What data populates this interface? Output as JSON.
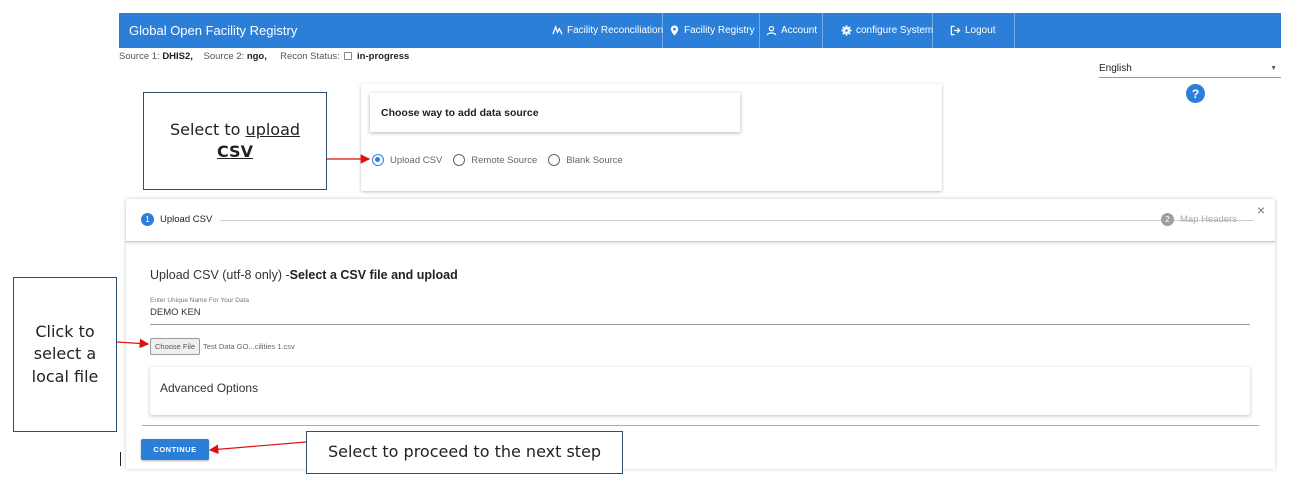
{
  "header": {
    "brand": "Global Open Facility Registry",
    "nav": [
      {
        "label": "Facility Reconciliation",
        "icon": "reconciliation-icon"
      },
      {
        "label": "Facility Registry",
        "icon": "location-pin-icon"
      },
      {
        "label": "Account",
        "icon": "user-icon"
      },
      {
        "label": "configure System",
        "icon": "gear-icon"
      },
      {
        "label": "Logout",
        "icon": "logout-icon"
      }
    ],
    "color": "#2b7fd8"
  },
  "status": {
    "source1_label": "Source 1:",
    "source1_value": "DHIS2,",
    "source2_label": "Source 2:",
    "source2_value": "ngo,",
    "recon_label": "Recon Status:",
    "recon_value": "in-progress"
  },
  "language": {
    "selected": "English"
  },
  "help": {
    "label": "?"
  },
  "source_card": {
    "title": "Choose way to add data source",
    "options": [
      {
        "label": "Upload CSV",
        "checked": true
      },
      {
        "label": "Remote Source",
        "checked": false
      },
      {
        "label": "Blank Source",
        "checked": false
      }
    ]
  },
  "stepper": {
    "steps": [
      {
        "number": "1",
        "label": "Upload CSV",
        "active": true
      },
      {
        "number": "2",
        "label": "Map Headers",
        "active": false
      }
    ],
    "close_label": "×"
  },
  "upload": {
    "heading_normal": "Upload CSV (utf-8 only) -",
    "heading_bold": "Select a CSV file and upload",
    "name_label": "Enter Unique Name For Your Data",
    "name_value": "DEMO KEN",
    "file_button": "Choose File",
    "file_name": "Test Data GO...cilities 1.csv",
    "advanced_label": "Advanced Options",
    "continue_label": "CONTINUE"
  },
  "callouts": {
    "upload_line1": "Select to ",
    "upload_underline": "upload",
    "upload_line2": "CSV",
    "file_line1": "Click to",
    "file_line2": "select a",
    "file_line3": "local file",
    "proceed": "Select to proceed to the next step"
  }
}
